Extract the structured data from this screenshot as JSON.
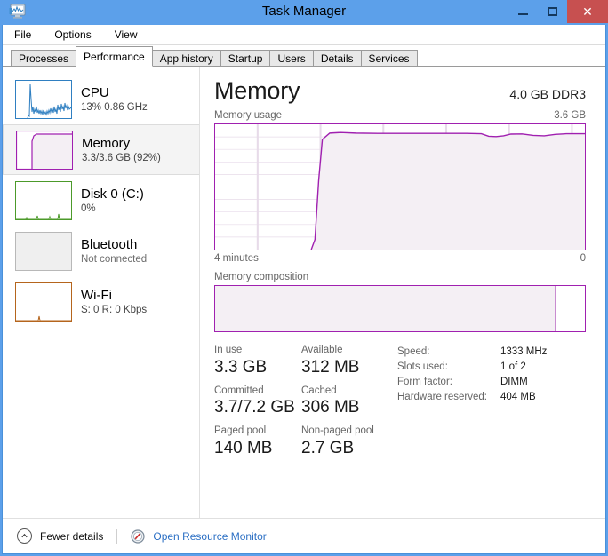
{
  "window": {
    "title": "Task Manager",
    "icon": "task-manager-monitor-icon",
    "controls": {
      "minimize": "–",
      "maximize": "□",
      "close": "✕"
    },
    "titlebar_color": "#5ca0ea",
    "close_color": "#c75050"
  },
  "menu": {
    "items": [
      "File",
      "Options",
      "View"
    ]
  },
  "tabs": {
    "items": [
      {
        "label": "Processes",
        "active": false
      },
      {
        "label": "Performance",
        "active": true
      },
      {
        "label": "App history",
        "active": false
      },
      {
        "label": "Startup",
        "active": false
      },
      {
        "label": "Users",
        "active": false
      },
      {
        "label": "Details",
        "active": false
      },
      {
        "label": "Services",
        "active": false
      }
    ]
  },
  "sidebar": {
    "items": [
      {
        "name": "CPU",
        "sub": "13% 0.86 GHz",
        "color": "#2f7fc1",
        "selected": false,
        "muted": false
      },
      {
        "name": "Memory",
        "sub": "3.3/3.6 GB (92%)",
        "color": "#a020b0",
        "selected": true,
        "muted": false
      },
      {
        "name": "Disk 0 (C:)",
        "sub": "0%",
        "color": "#4c9a2a",
        "selected": false,
        "muted": false
      },
      {
        "name": "Bluetooth",
        "sub": "Not connected",
        "color": "#b0b0b0",
        "selected": false,
        "muted": true
      },
      {
        "name": "Wi-Fi",
        "sub": "S: 0 R: 0 Kbps",
        "color": "#b5651d",
        "selected": false,
        "muted": false
      }
    ]
  },
  "main": {
    "title": "Memory",
    "capacity": "4.0 GB DDR3",
    "usage_label": "Memory usage",
    "usage_max": "3.6 GB",
    "axis_left": "4 minutes",
    "axis_right": "0",
    "composition_label": "Memory composition",
    "accent_color": "#a020b0",
    "fill_color": "#f4eff4"
  },
  "chart_data": {
    "type": "area",
    "title": "Memory usage",
    "xlabel": "4 minutes",
    "ylabel": "3.6 GB",
    "ylim": [
      0,
      3.6
    ],
    "xlim": [
      0,
      100
    ],
    "grid": true,
    "legend": false,
    "line_color": "#a020b0",
    "fill_color": "#f4eff4",
    "grid_rows": 10,
    "grid_cols": 6,
    "x": [
      0,
      5,
      10,
      15,
      20,
      24,
      26,
      27,
      28,
      29,
      31,
      34,
      38,
      44,
      50,
      56,
      62,
      68,
      72,
      74,
      76,
      78,
      80,
      83,
      86,
      89,
      92,
      95,
      98,
      100
    ],
    "values_percent": [
      0,
      0,
      0,
      0,
      0,
      0,
      0,
      8,
      55,
      88,
      93,
      93.5,
      93,
      92.8,
      92.8,
      92.8,
      92.8,
      92.8,
      92.5,
      90.5,
      90.2,
      90.8,
      92.2,
      92.3,
      91.2,
      90.8,
      92,
      92.5,
      92.5,
      92.5
    ],
    "current_percent": 92
  },
  "composition": {
    "used_percent": 92,
    "free_percent": 8
  },
  "stats": {
    "left": [
      [
        {
          "caption": "In use",
          "value": "3.3 GB"
        },
        {
          "caption": "Available",
          "value": "312 MB"
        }
      ],
      [
        {
          "caption": "Committed",
          "value": "3.7/7.2 GB"
        },
        {
          "caption": "Cached",
          "value": "306 MB"
        }
      ],
      [
        {
          "caption": "Paged pool",
          "value": "140 MB"
        },
        {
          "caption": "Non-paged pool",
          "value": "2.7 GB"
        }
      ]
    ],
    "right": [
      {
        "caption": "Speed:",
        "value": "1333 MHz"
      },
      {
        "caption": "Slots used:",
        "value": "1 of 2"
      },
      {
        "caption": "Form factor:",
        "value": "DIMM"
      },
      {
        "caption": "Hardware reserved:",
        "value": "404 MB"
      }
    ]
  },
  "footer": {
    "fewer_details": "Fewer details",
    "chevron": "▲",
    "resource_monitor": "Open Resource Monitor",
    "link_color": "#2b6fc4"
  }
}
